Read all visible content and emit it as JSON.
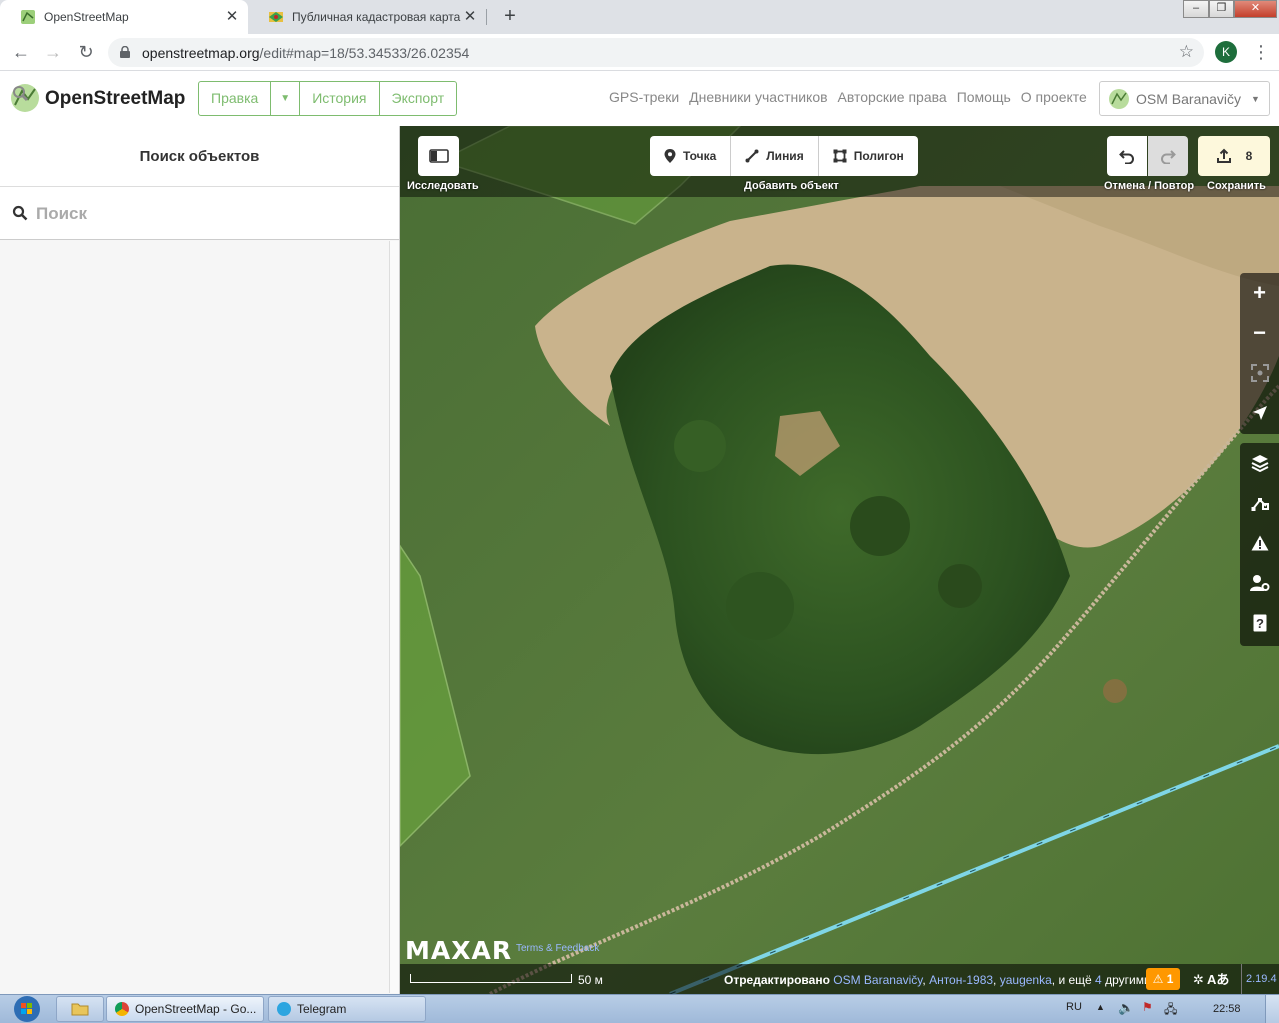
{
  "browser": {
    "tabs": [
      {
        "title": "OpenStreetMap",
        "active": true,
        "favicon": "osm-icon"
      },
      {
        "title": "Публичная кадастровая карта",
        "active": false,
        "favicon": "cadastral-map-icon"
      }
    ],
    "url_host": "openstreetmap.org",
    "url_path": "/edit#map=18/53.34533/26.02354",
    "profile_initial": "K"
  },
  "osm": {
    "brand": "OpenStreetMap",
    "edit_group": {
      "edit": "Правка",
      "history": "История",
      "export": "Экспорт"
    },
    "nav": [
      "GPS-треки",
      "Дневники участников",
      "Авторские права",
      "Помощь",
      "О проекте"
    ],
    "user": "OSM Baranavičy"
  },
  "sidebar": {
    "title": "Поиск объектов",
    "search_placeholder": "Поиск"
  },
  "map": {
    "explore_label": "Исследовать",
    "add_buttons": {
      "point": "Точка",
      "line": "Линия",
      "area": "Полигон"
    },
    "add_label": "Добавить объект",
    "undo_redo_label": "Отмена / Повтор",
    "save_count": "8",
    "save_label": "Сохранить",
    "imagery_provider": "MAXAR",
    "imagery_terms": "Terms & Feedback",
    "scale": "50 м",
    "attribution": {
      "prefix": "Отредактировано",
      "users": [
        "OSM Baranavičy",
        "Антон-1983",
        "yaugenka"
      ],
      "and_more": "и ещё",
      "more_count": "4",
      "suffix": "другими"
    },
    "issues_count": "1",
    "dev_label": "Aあ",
    "version": "2.19.4",
    "colors": {
      "accent": "#7ebc6f",
      "path": "#c9b79a",
      "power_line": "#7fd6e6"
    }
  },
  "taskbar": {
    "items": [
      "OpenStreetMap - Go...",
      "Telegram"
    ],
    "language": "RU",
    "time": "22:58"
  }
}
